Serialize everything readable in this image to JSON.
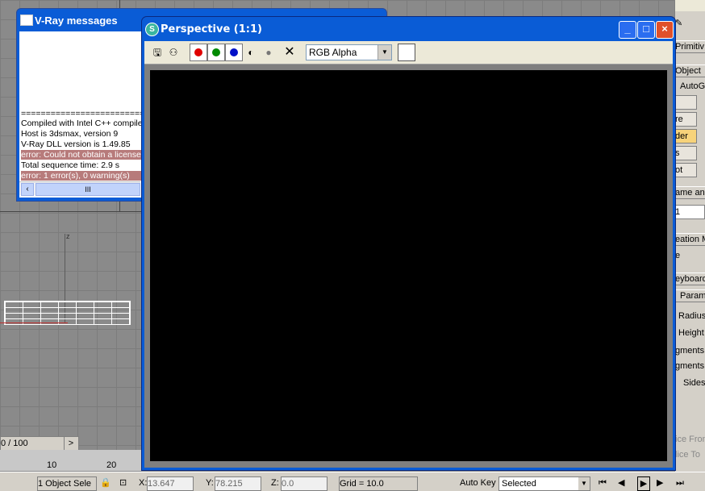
{
  "vray_window": {
    "title": "V-Ray messages",
    "separator": "================================",
    "lines": [
      {
        "text": "Compiled with Intel C++ compiler",
        "error": false
      },
      {
        "text": "Host is 3dsmax, version 9",
        "error": false
      },
      {
        "text": "V-Ray DLL version is 1.49.85",
        "error": false
      },
      {
        "text": "error: Could not obtain a license",
        "error": true
      },
      {
        "text": "Total sequence time: 2.9 s",
        "error": false
      },
      {
        "text": "error: 1 error(s), 0 warning(s)",
        "error": true
      }
    ],
    "scroll_grip": "III"
  },
  "perspective_window": {
    "title": "Perspective (1:1)",
    "channel_select": "RGB Alpha",
    "channel_colors": {
      "red": "#e00000",
      "green": "#008a00",
      "blue": "#0010c8"
    },
    "minimize": "_",
    "maximize": "□",
    "close": "×"
  },
  "command_panel": {
    "primitives": "Primitiv",
    "object_type": "Object",
    "autogrid": "AutoG",
    "btn_labels": [
      "",
      "re",
      "der",
      "s",
      "ot"
    ],
    "name_and": "ame an",
    "name_value": "1",
    "creation": "eation M",
    "creation_value": "e",
    "keyboard": "eyboard",
    "params": "Parame",
    "param_labels": [
      "Radius",
      "Height",
      "gments",
      "gments",
      "Sides"
    ],
    "slice_from": "ice From",
    "slice_to": "lice To"
  },
  "timeline": {
    "frame": "0 / 100",
    "next": ">",
    "ticks": [
      "10",
      "20"
    ]
  },
  "status": {
    "selection": "1 Object Sele",
    "x_label": "X:",
    "x_value": "13.647",
    "y_label": "Y:",
    "y_value": "78.215",
    "z_label": "Z:",
    "z_value": "0.0",
    "grid": "Grid = 10.0",
    "auto_key": "Auto Key",
    "key_filter": "Selected"
  }
}
